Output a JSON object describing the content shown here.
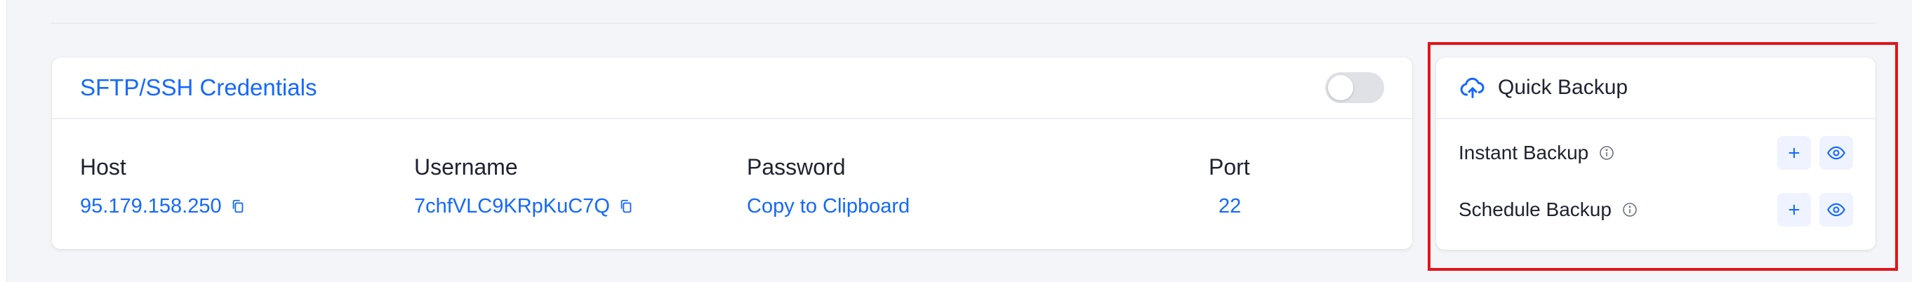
{
  "sftp": {
    "title": "SFTP/SSH Credentials",
    "toggle_on": false,
    "host_label": "Host",
    "host_value": "95.179.158.250",
    "username_label": "Username",
    "username_value": "7chfVLC9KRpKuC7Q",
    "password_label": "Password",
    "password_value": "Copy to Clipboard",
    "port_label": "Port",
    "port_value": "22"
  },
  "quick_backup": {
    "title": "Quick Backup",
    "rows": [
      {
        "label": "Instant Backup",
        "add_icon": "plus-icon",
        "view_icon": "eye-icon"
      },
      {
        "label": "Schedule Backup",
        "add_icon": "plus-icon",
        "view_icon": "eye-icon"
      }
    ]
  },
  "colors": {
    "accent": "#1468ff",
    "highlight": "#e3141b",
    "background": "#f4f5f8"
  }
}
